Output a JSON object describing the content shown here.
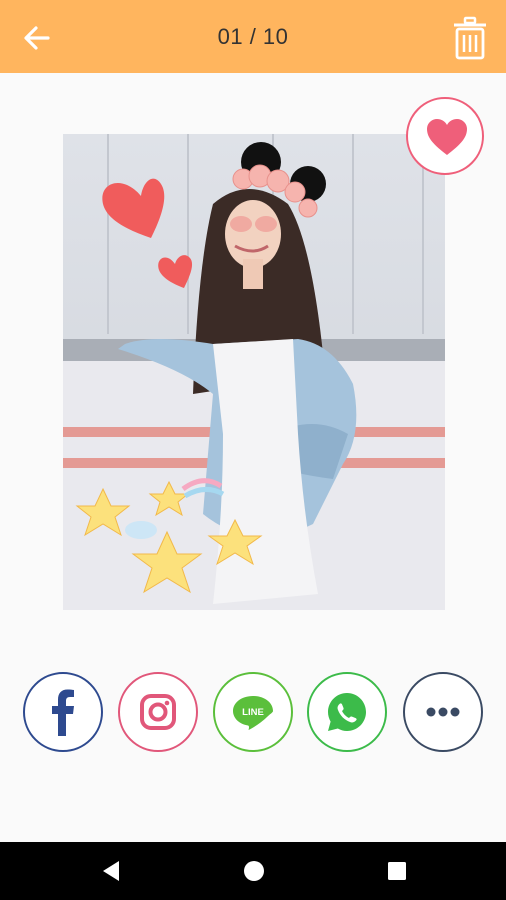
{
  "header": {
    "counter": "01 / 10",
    "back_icon": "arrow-left-icon",
    "delete_icon": "trash-icon",
    "bar_color": "#ffb55e"
  },
  "photo": {
    "stickers": [
      "heart-sticker",
      "heart-sticker-small",
      "mouse-ears-flower-crown",
      "star-sticker",
      "shooting-star-sticker"
    ]
  },
  "favorite": {
    "icon": "heart-icon",
    "color": "#ef5f7a"
  },
  "share": [
    {
      "name": "facebook",
      "icon": "facebook-icon",
      "color": "#2e4a8f"
    },
    {
      "name": "instagram",
      "icon": "instagram-icon",
      "color": "#e1577a"
    },
    {
      "name": "line",
      "icon": "line-icon",
      "label": "LINE",
      "color": "#5bbf3b"
    },
    {
      "name": "whatsapp",
      "icon": "whatsapp-icon",
      "color": "#3cbb4a"
    },
    {
      "name": "more",
      "icon": "more-icon",
      "color": "#3a4a63"
    }
  ],
  "navigation": {
    "back_icon": "triangle-back-icon",
    "home_icon": "circle-home-icon",
    "recents_icon": "square-recents-icon"
  }
}
